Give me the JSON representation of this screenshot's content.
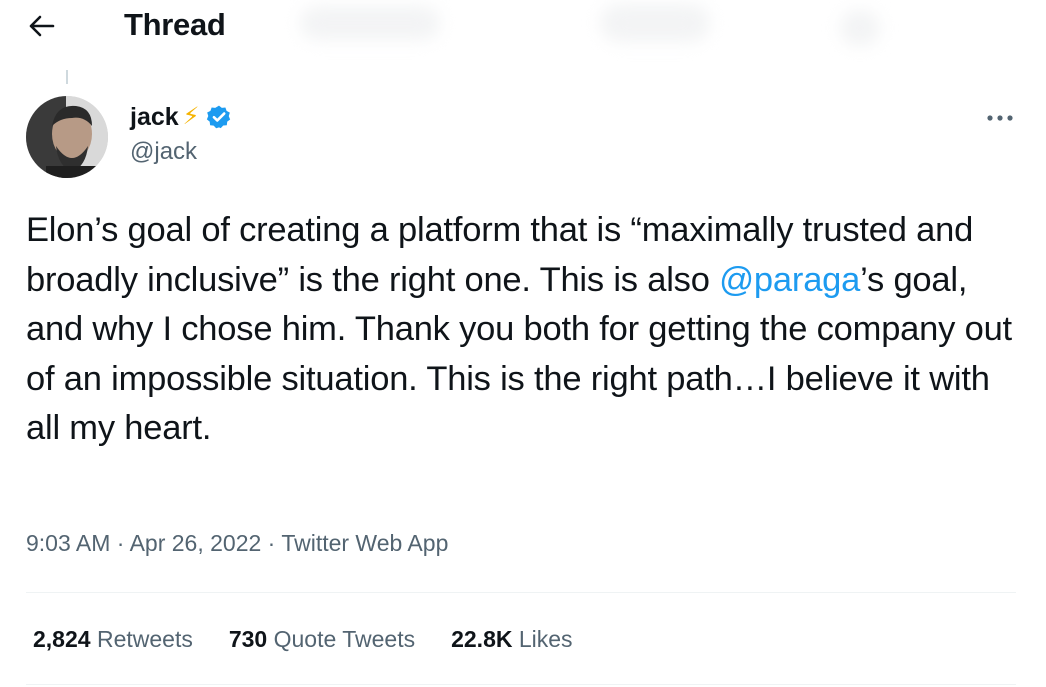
{
  "header": {
    "title": "Thread"
  },
  "tweet": {
    "author": {
      "name": "jack",
      "emoji": "⚡",
      "handle": "@jack",
      "verified": true
    },
    "text": {
      "part1": "Elon’s goal of creating a platform that is “maximally trusted and broadly inclusive” is the right one. This is also ",
      "mention": "@paraga",
      "part2": "’s goal, and why I chose him. Thank you both for getting the company out of an impossible situation. This is the right path…I believe it with all my heart."
    },
    "meta": {
      "time": "9:03 AM",
      "separator": " · ",
      "date": "Apr 26, 2022",
      "source": "Twitter Web App"
    },
    "stats": {
      "retweets_count": "2,824",
      "retweets_label": "Retweets",
      "quotes_count": "730",
      "quotes_label": "Quote Tweets",
      "likes_count": "22.8K",
      "likes_label": "Likes"
    }
  },
  "colors": {
    "accent": "#1d9bf0",
    "text_primary": "#0f1419",
    "text_secondary": "#536471",
    "divider": "#eff3f4"
  },
  "icons": {
    "back": "arrow-left-icon",
    "verified": "verified-badge-icon",
    "more": "more-horizontal-icon"
  }
}
